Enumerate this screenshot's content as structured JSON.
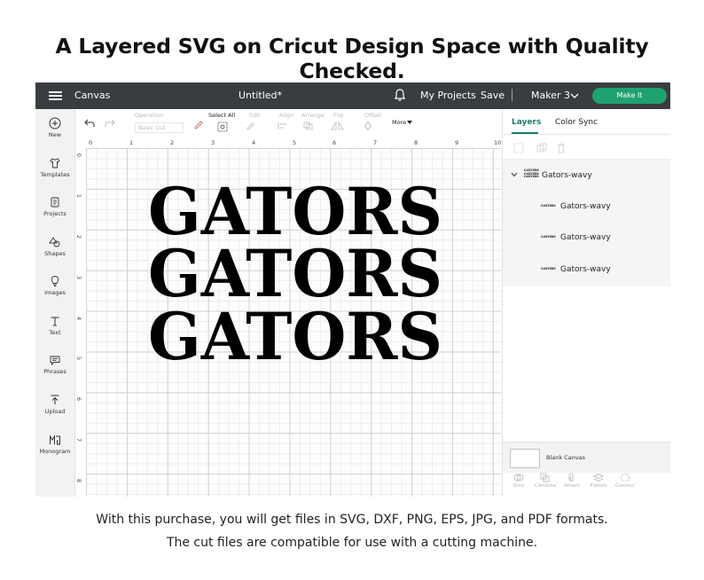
{
  "headline": "A Layered SVG on Cricut Design Space with Quality Checked.",
  "footer": {
    "line1": "With this purchase, you will get files in SVG, DXF, PNG, EPS, JPG, and PDF formats.",
    "line2": "The cut files are compatible for use with a cutting machine."
  },
  "topbar": {
    "section": "Canvas",
    "title": "Untitled*",
    "my_projects": "My Projects",
    "save": "Save",
    "machine": "Maker 3",
    "make_it": "Make It"
  },
  "sidebar": {
    "items": [
      {
        "label": "New",
        "icon": "plus-circle-icon"
      },
      {
        "label": "Templates",
        "icon": "shirt-icon"
      },
      {
        "label": "Projects",
        "icon": "projects-icon"
      },
      {
        "label": "Shapes",
        "icon": "shapes-icon"
      },
      {
        "label": "Images",
        "icon": "bulb-icon"
      },
      {
        "label": "Text",
        "icon": "text-icon"
      },
      {
        "label": "Phrases",
        "icon": "speech-bubble-icon"
      },
      {
        "label": "Upload",
        "icon": "upload-icon"
      },
      {
        "label": "Monogram",
        "icon": "monogram-icon"
      }
    ]
  },
  "toolbar": {
    "operation_label": "Operation",
    "operation_value": "Basic Cut",
    "select_all": "Select All",
    "edit": "Edit",
    "align": "Align",
    "arrange": "Arrange",
    "flip": "Flip",
    "offset": "Offset",
    "more": "More"
  },
  "ruler": {
    "top": [
      "0",
      "1",
      "2",
      "3",
      "4",
      "5",
      "6",
      "7",
      "8",
      "9",
      "10"
    ],
    "left": [
      "0",
      "1",
      "2",
      "3",
      "4",
      "5",
      "6",
      "7",
      "8"
    ]
  },
  "canvas": {
    "words": [
      "GATORS",
      "GATORS",
      "GATORS"
    ]
  },
  "panel": {
    "tabs": [
      "Layers",
      "Color Sync"
    ],
    "group": {
      "name": "Gators-wavy",
      "thumb": "GATORS"
    },
    "layers": [
      {
        "name": "Gators-wavy",
        "thumb": "GATORS"
      },
      {
        "name": "Gators-wavy",
        "thumb": "GATORS"
      },
      {
        "name": "Gators-wavy",
        "thumb": "GATORS"
      }
    ],
    "blank_canvas": "Blank Canvas",
    "tools": [
      "Slice",
      "Combine",
      "Attach",
      "Flatten",
      "Contour"
    ]
  },
  "colors": {
    "topbar": "#3a3d40",
    "accent_green": "#1ea36f",
    "tab_active": "#1c7e6a"
  }
}
